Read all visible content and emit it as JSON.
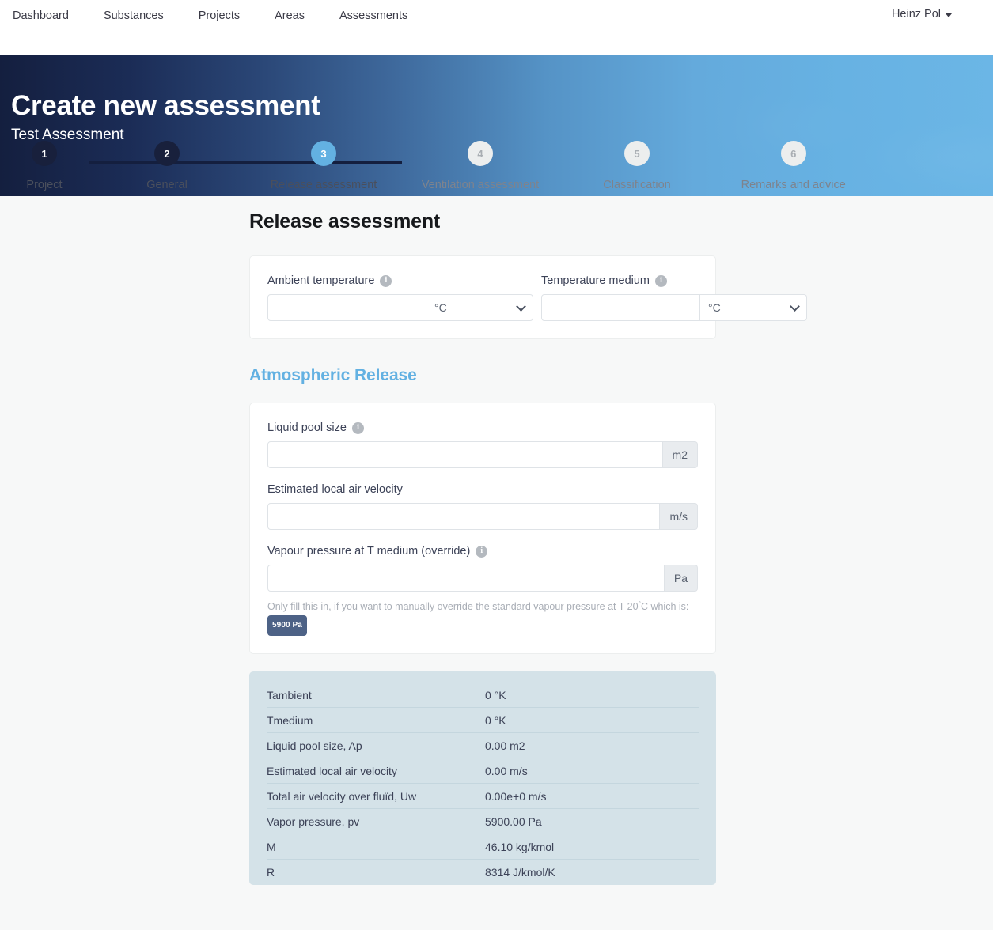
{
  "nav": {
    "links": [
      {
        "label": "Dashboard"
      },
      {
        "label": "Substances"
      },
      {
        "label": "Projects"
      },
      {
        "label": "Areas"
      },
      {
        "label": "Assessments"
      }
    ],
    "user": "Heinz Pol",
    "caret_icon": "chevron-down-icon"
  },
  "hero": {
    "title": "Create new assessment",
    "subtitle": "Test Assessment"
  },
  "stepper": {
    "steps": [
      {
        "number": "1",
        "label": "Project",
        "state": "done"
      },
      {
        "number": "2",
        "label": "General",
        "state": "done"
      },
      {
        "number": "3",
        "label": "Release assessment",
        "state": "active"
      },
      {
        "number": "4",
        "label": "Ventilation assessment",
        "state": "todo"
      },
      {
        "number": "5",
        "label": "Classification",
        "state": "todo"
      },
      {
        "number": "6",
        "label": "Remarks and advice",
        "state": "todo"
      }
    ]
  },
  "main": {
    "section_title": "Release assessment",
    "temperature_card": {
      "ambient": {
        "label": "Ambient temperature",
        "info_icon": "info-icon",
        "value": "",
        "placeholder": "",
        "unit": "°C"
      },
      "medium": {
        "label": "Temperature medium",
        "info_icon": "info-icon",
        "value": "",
        "placeholder": "",
        "unit": "°C"
      }
    },
    "atmospheric": {
      "title": "Atmospheric Release",
      "liquid_pool": {
        "label": "Liquid pool size",
        "info_icon": "info-icon",
        "value": "",
        "placeholder": "",
        "unit": "m2"
      },
      "air_velocity": {
        "label": "Estimated local air velocity",
        "value": "",
        "placeholder": "",
        "unit": "m/s"
      },
      "vapour_pressure": {
        "label": "Vapour pressure at T medium (override)",
        "info_icon": "info-icon",
        "value": "",
        "placeholder": "",
        "unit": "Pa",
        "help_prefix": "Only fill this in, if you want to manually override the standard vapour pressure at T 20",
        "help_degree": "°",
        "help_middle": "C which is:",
        "badge": "5900 Pa"
      }
    },
    "results": {
      "rows": [
        {
          "key": "Tambient",
          "value": "0 °K"
        },
        {
          "key": "Tmedium",
          "value": "0 °K"
        },
        {
          "key": "Liquid pool size, Ap",
          "value": "0.00 m2"
        },
        {
          "key": "Estimated local air velocity",
          "value": "0.00 m/s"
        },
        {
          "key": "Total air velocity over fluïd, Uw",
          "value": "0.00e+0 m/s"
        },
        {
          "key": "Vapor pressure, pv",
          "value": "5900.00 Pa"
        },
        {
          "key": "M",
          "value": "46.10 kg/kmol"
        },
        {
          "key": "R",
          "value": "8314 J/kmol/K"
        }
      ]
    }
  },
  "colors": {
    "accent": "#63b1e2",
    "navy": "#18203c",
    "badge": "#4d6286",
    "panel": "#d4e2e8"
  }
}
